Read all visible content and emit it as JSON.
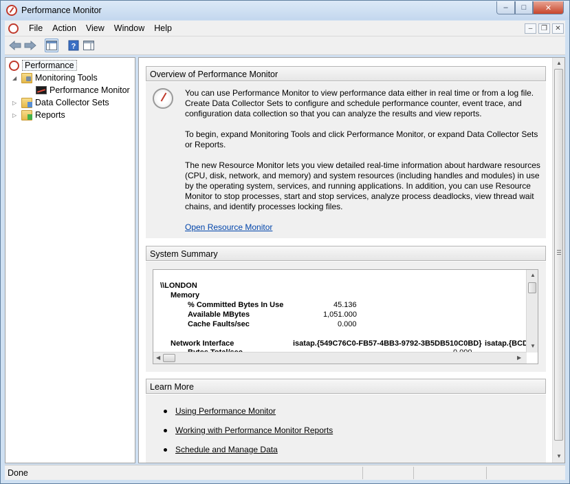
{
  "window": {
    "title": "Performance Monitor"
  },
  "window_buttons": {
    "minimize": "–",
    "maximize": "□",
    "close": "✕"
  },
  "menu": {
    "items": [
      {
        "label": "File"
      },
      {
        "label": "Action"
      },
      {
        "label": "View"
      },
      {
        "label": "Window"
      },
      {
        "label": "Help"
      }
    ],
    "mdi_buttons": {
      "minimize": "–",
      "restore": "❐",
      "close": "✕"
    }
  },
  "toolbar": {
    "icons": [
      "back-arrow-icon",
      "forward-arrow-icon",
      "show-console-tree-icon",
      "help-icon",
      "show-action-pane-icon"
    ]
  },
  "tree": {
    "root": {
      "label": "Performance"
    },
    "items": [
      {
        "label": "Monitoring Tools",
        "expanded": true
      },
      {
        "label": "Performance Monitor"
      },
      {
        "label": "Data Collector Sets",
        "expanded": false
      },
      {
        "label": "Reports",
        "expanded": false
      }
    ]
  },
  "overview": {
    "header": "Overview of Performance Monitor",
    "para1": "You can use Performance Monitor to view performance data either in real time or from a log file. Create Data Collector Sets to configure and schedule performance counter, event trace, and configuration data collection so that you can analyze the results and view reports.",
    "para2": "To begin, expand Monitoring Tools and click Performance Monitor, or expand Data Collector Sets or Reports.",
    "para3": "The new Resource Monitor lets you view detailed real-time information about hardware resources (CPU, disk, network, and memory) and system resources (including handles and modules) in use by the operating system, services, and running applications. In addition, you can use Resource Monitor to stop processes, start and stop services, analyze process deadlocks, view thread wait chains, and identify processes locking files.",
    "link": "Open Resource Monitor"
  },
  "summary": {
    "header": "System Summary",
    "computer": "\\\\LONDON",
    "memory_label": "Memory",
    "counters": [
      {
        "name": "% Committed Bytes In Use",
        "value": "45.136"
      },
      {
        "name": "Available MBytes",
        "value": "1,051.000"
      },
      {
        "name": "Cache Faults/sec",
        "value": "0.000"
      }
    ],
    "network_label": "Network Interface",
    "network_instance1": "isatap.{549C76C0-FB57-4BB3-9792-3B5DB510C0BD}",
    "network_instance2": "isatap.{BCD",
    "partial_counter": "Bytes Total/sec",
    "partial_value": "0.000"
  },
  "learn_more": {
    "header": "Learn More",
    "links": [
      {
        "label": "Using Performance Monitor"
      },
      {
        "label": "Working with Performance Monitor Reports"
      },
      {
        "label": "Schedule and Manage Data"
      }
    ]
  },
  "status": {
    "text": "Done"
  }
}
